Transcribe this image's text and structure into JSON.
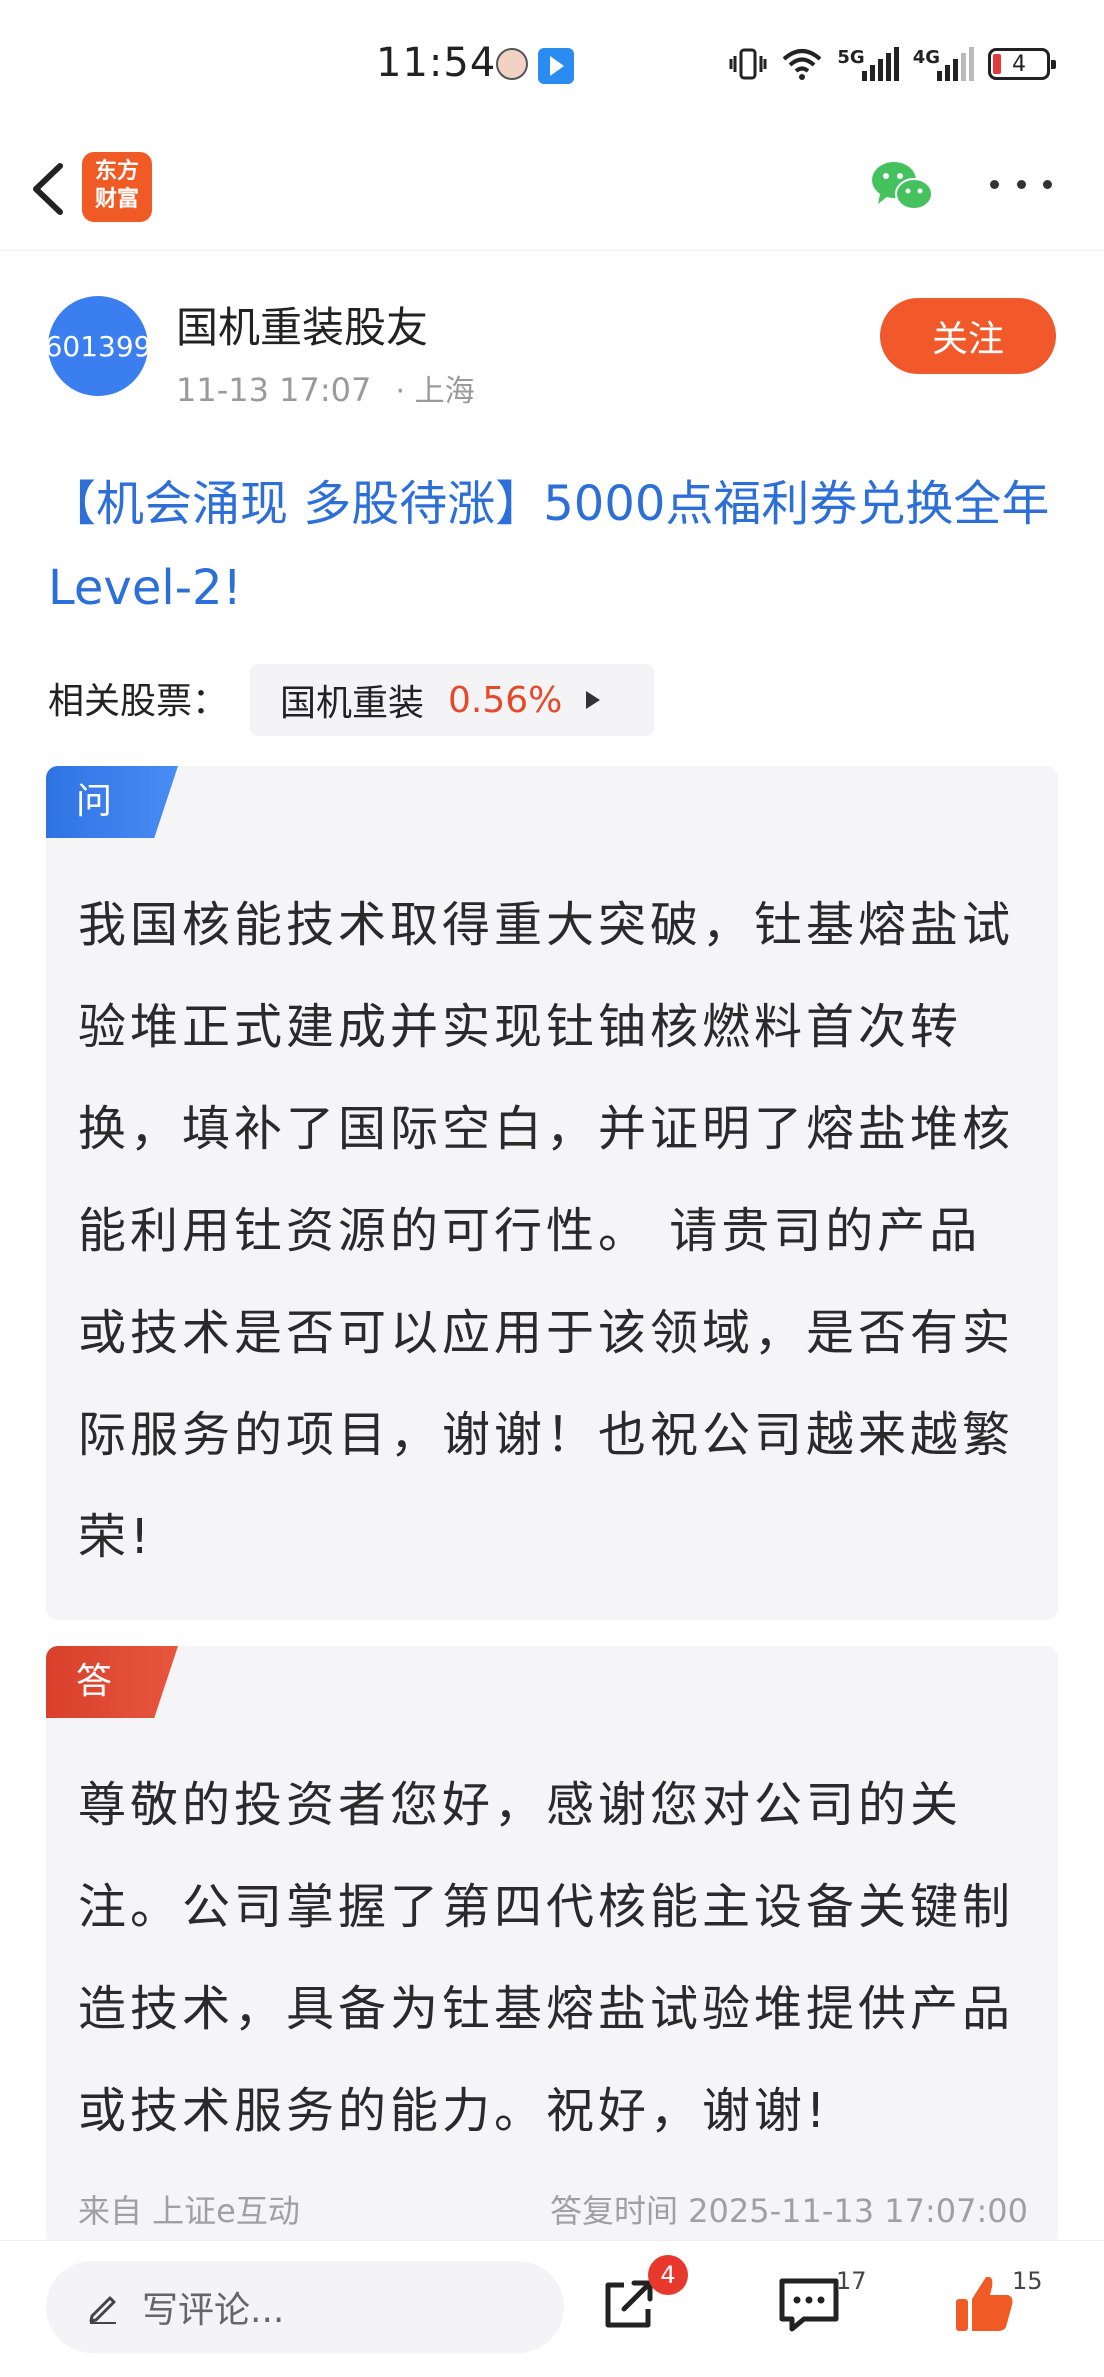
{
  "status_bar": {
    "time": "11:54",
    "network_5g": "5G",
    "network_4g": "4G",
    "battery": "4"
  },
  "nav": {
    "logo_text_line1": "东方",
    "logo_text_line2": "财富"
  },
  "author": {
    "avatar_text": "601399",
    "name": "国机重装股友",
    "datetime": "11-13 17:07",
    "location": "· 上海",
    "follow_label": "关注"
  },
  "post": {
    "title": "【机会涌现 多股待涨】5000点福利券兑换全年Level-2!",
    "related_label": "相关股票：",
    "stock": {
      "name": "国机重装",
      "change": "0.56%"
    }
  },
  "question": {
    "tag": "问",
    "text": "我国核能技术取得重大突破，钍基熔盐试验堆正式建成并实现钍铀核燃料首次转换，填补了国际空白，并证明了熔盐堆核能利用钍资源的可行性。 请贵司的产品或技术是否可以应用于该领域，是否有实际服务的项目，谢谢！也祝公司越来越繁荣!"
  },
  "answer": {
    "tag": "答",
    "text": "尊敬的投资者您好，感谢您对公司的关注。公司掌握了第四代核能主设备关键制造技术，具备为钍基熔盐试验堆提供产品或技术服务的能力。祝好，谢谢!",
    "source": "来自 上证e互动",
    "reply_time": "答复时间 2025-11-13 17:07:00"
  },
  "bottom_bar": {
    "comment_placeholder": "写评论...",
    "share_badge": "4",
    "comment_count": "17",
    "like_count": "15"
  },
  "colors": {
    "accent_orange": "#f2592a",
    "title_blue": "#2d6fd8",
    "question_blue": "#2f73e3",
    "answer_red": "#d8402c",
    "stock_up": "#e44a2a"
  }
}
